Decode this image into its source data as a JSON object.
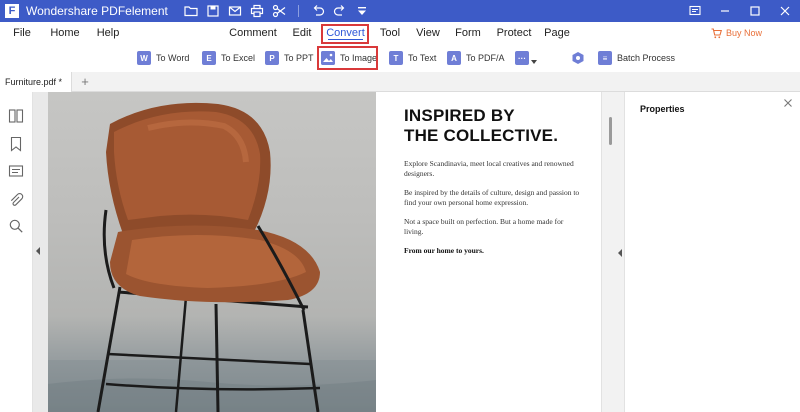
{
  "app": {
    "logo_letter": "F",
    "title": "Wondershare PDFelement"
  },
  "quick_toolbar": [
    "folder-icon",
    "save-icon",
    "mail-icon",
    "print-icon",
    "scissors-icon",
    "undo-icon",
    "redo-icon",
    "customize-icon"
  ],
  "window_controls": [
    "feedback-icon",
    "minimize-icon",
    "maximize-icon",
    "close-icon"
  ],
  "menu": {
    "items": [
      {
        "id": "file",
        "label": "File"
      },
      {
        "id": "home",
        "label": "Home"
      },
      {
        "id": "help",
        "label": "Help"
      },
      {
        "id": "comment",
        "label": "Comment"
      },
      {
        "id": "edit",
        "label": "Edit"
      },
      {
        "id": "convert",
        "label": "Convert",
        "active": true
      },
      {
        "id": "tool",
        "label": "Tool"
      },
      {
        "id": "view",
        "label": "View"
      },
      {
        "id": "form",
        "label": "Form"
      },
      {
        "id": "protect",
        "label": "Protect"
      },
      {
        "id": "page",
        "label": "Page"
      }
    ],
    "buy_now": "Buy Now"
  },
  "convert_toolbar": {
    "to_word": "To Word",
    "to_excel": "To Excel",
    "to_ppt": "To PPT",
    "to_image": "To Image",
    "to_text": "To Text",
    "to_pdfa": "To PDF/A",
    "batch_process": "Batch Process"
  },
  "tabs": {
    "document": "Furniture.pdf *",
    "add": "+"
  },
  "document": {
    "heading_line1": "INSPIRED BY",
    "heading_line2": "THE COLLECTIVE.",
    "paragraphs": [
      "Explore Scandinavia, meet local creatives and renowned designers.",
      "Be inspired by the details of culture, design and passion to find your own personal home expression.",
      "Not a space built on perfection. But a home made for living."
    ],
    "closing": "From our home to yours."
  },
  "properties": {
    "title": "Properties"
  },
  "colors": {
    "titlebar": "#3d5bc7",
    "accent": "#2f57d8",
    "highlight": "#d9393a",
    "buy_now": "#e8703a",
    "chair_leather": "#9b5430"
  }
}
